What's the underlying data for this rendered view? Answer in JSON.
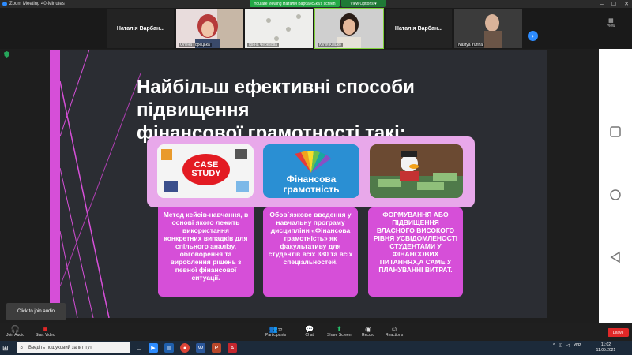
{
  "window": {
    "title": "Zoom Meeting 40-Minutes",
    "banner": "You are viewing Наталія Варбанська's screen",
    "view_options": "View Options ▾",
    "view_label": "View"
  },
  "gallery": [
    {
      "name": "Наталія Варбан...",
      "type": "nameonly"
    },
    {
      "name": "Олена Горецька",
      "type": "video"
    },
    {
      "name": "Ірина Черезова",
      "type": "video"
    },
    {
      "name": "Юлія Кліцко",
      "type": "video"
    },
    {
      "name": "Наталія Варбан...",
      "type": "nameonly"
    },
    {
      "name": "Nastya Yurina",
      "type": "video"
    }
  ],
  "slide": {
    "title_line1": "Найбільш ефективні способи підвищення",
    "title_line2": "фінансової грамотності такі:",
    "case_study_label": "CASE STUDY",
    "fin_label_line1": "Фінансова",
    "fin_label_line2": "грамотність",
    "desc1": "Метод кейсів-навчання, в основі якого лежить використання конкретних випадків для спільного аналізу, обговорення та вироблення рішень з певної фінансової ситуації.",
    "desc2": "Обов`язкове введення у навчальну програму дисципліни «Фінансова грамотність» як факультативу для студентів всіх 380 та всіх спеціальностей.",
    "desc3": "ФОРМУВАННЯ АБО ПІДВИЩЕННЯ ВЛАСНОГО ВИСОКОГО РІВНЯ УСВІДОМЛЕНОСТІ СТУДЕНТАМИ У ФІНАНСОВИХ ПИТАННЯХ,А САМЕ У ПЛАНУВАННІ ВИТРАТ."
  },
  "join_tip": "Click to join audio",
  "toolbar": {
    "join_audio": "Join Audio",
    "start_video": "Start Video",
    "participants": "Participants",
    "participants_count": "22",
    "chat": "Chat",
    "share_screen": "Share Screen",
    "record": "Record",
    "reactions": "Reactions",
    "leave": "Leave"
  },
  "taskbar": {
    "search_placeholder": "Введіть пошуковий запит тут",
    "language": "УКР",
    "time": "11:02",
    "date": "11.05.2021"
  }
}
